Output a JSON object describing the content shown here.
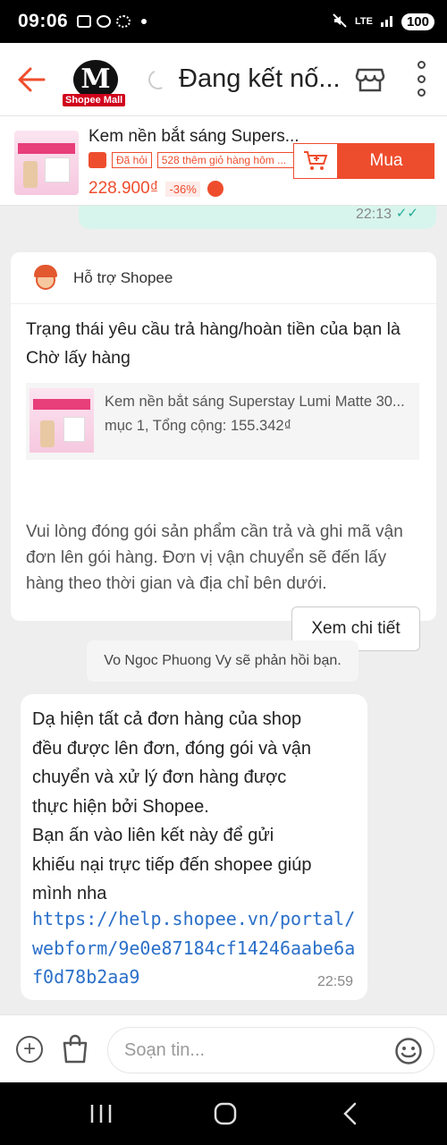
{
  "status": {
    "time": "09:06",
    "network": "LTE",
    "battery": "100"
  },
  "header": {
    "logo_text": "M",
    "logo_badge": "Shopee Mall",
    "title": "Đang kết nố..."
  },
  "product": {
    "name": "Kem nền bắt sáng Supers...",
    "asked_tag": "Đã hỏi",
    "cart_tag": "528 thêm giỏ hàng hôm ...",
    "price": "228.900₫",
    "discount": "-36%",
    "buy_label": "Mua"
  },
  "chat": {
    "prev_time": "22:13",
    "card": {
      "sender": "Hỗ trợ Shopee",
      "status_text": "Trạng thái yêu cầu trả hàng/hoàn tiền của bạn là Chờ lấy hàng",
      "order_name": "Kem nền bắt sáng Superstay Lumi Matte 30...",
      "order_info": "mục 1, Tổng cộng: 155.342₫",
      "description": "Vui lòng đóng gói sản phẩm cần trả và ghi mã vận đơn lên gói hàng. Đơn vị vận chuyển sẽ đến lấy hàng theo thời gian và địa chỉ bên dưới.",
      "detail_button": "Xem chi tiết"
    },
    "system_note": "Vo Ngoc Phuong Vy sẽ phản hồi bạn.",
    "message": {
      "text": "Dạ hiện tất cả đơn hàng của shop\nđều được lên đơn, đóng gói và vận\nchuyển và xử lý đơn hàng được\nthực hiện bởi Shopee.\nBạn ấn vào liên kết này để gửi\nkhiếu nại trực tiếp đến shopee giúp\nmình nha",
      "link": "https://help.shopee.vn/portal/webform/9e0e87184cf14246aabe6af0d78b2aa9",
      "time": "22:59"
    }
  },
  "input": {
    "placeholder": "Soạn tin..."
  },
  "icons": {
    "back": "arrow-left-icon",
    "shop": "store-icon",
    "more": "more-vertical-icon",
    "cart": "add-to-cart-icon",
    "plus": "plus-circle-icon",
    "bag": "shopping-bag-icon",
    "emoji": "smiley-icon"
  },
  "colors": {
    "brand": "#ee4d2d",
    "link": "#2a6fc9",
    "sent_bubble": "#d7f5ec"
  }
}
